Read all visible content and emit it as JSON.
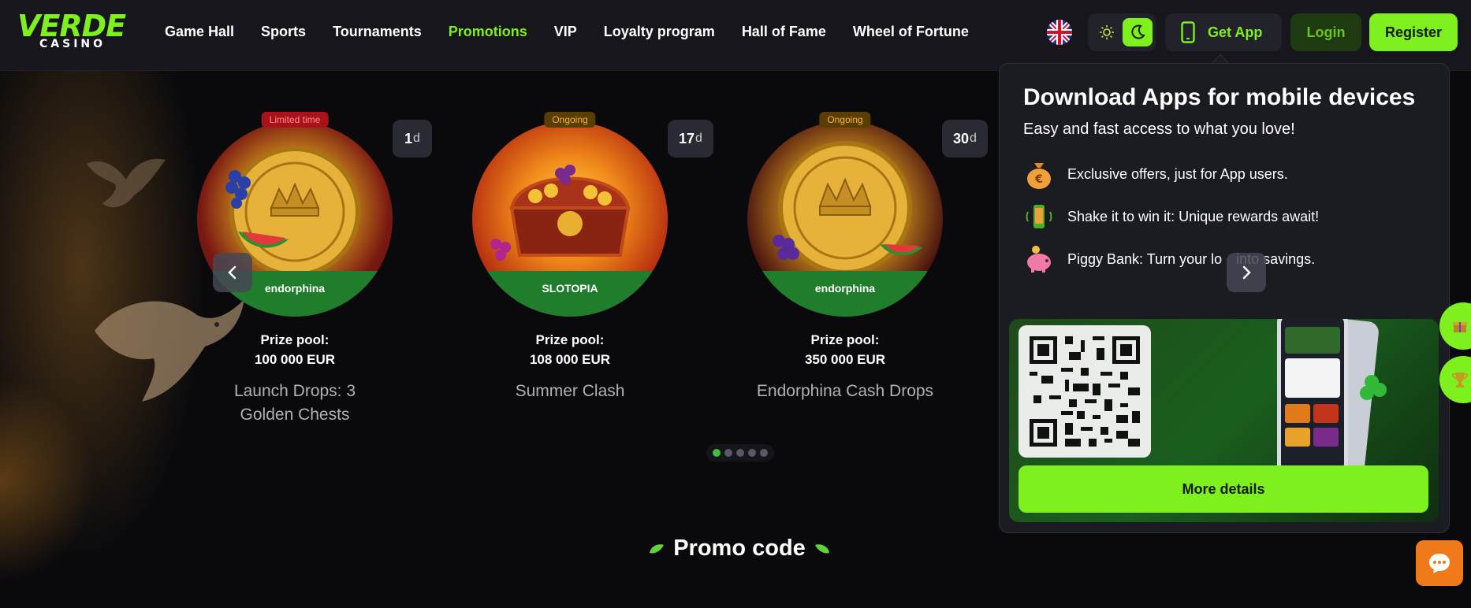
{
  "header": {
    "logo_main": "VERDE",
    "logo_sub": "CASINO",
    "nav": [
      "Game Hall",
      "Sports",
      "Tournaments",
      "Promotions",
      "VIP",
      "Loyalty program",
      "Hall of Fame",
      "Wheel of Fortune"
    ],
    "active_nav": "Promotions",
    "get_app_label": "Get App",
    "login_label": "Login",
    "register_label": "Register"
  },
  "tournaments": [
    {
      "badge": "Limited time",
      "days": "1",
      "days_unit": "d",
      "brand": "endorphina",
      "prize_label": "Prize pool:",
      "prize_value": "100 000 EUR",
      "title": "Launch Drops: 3 Golden Chests"
    },
    {
      "badge": "Ongoing",
      "days": "17",
      "days_unit": "d",
      "brand": "SLOTOPIA",
      "prize_label": "Prize pool:",
      "prize_value": "108 000 EUR",
      "title": "Summer Clash"
    },
    {
      "badge": "Ongoing",
      "days": "30",
      "days_unit": "d",
      "brand": "endorphina",
      "prize_label": "Prize pool:",
      "prize_value": "350 000 EUR",
      "title": "Endorphina Cash Drops"
    }
  ],
  "carousel": {
    "dot_count": 5,
    "active_dot": 0
  },
  "promo_section": {
    "title": "Promo code"
  },
  "popup": {
    "title": "Download Apps for mobile devices",
    "subtitle": "Easy and fast access to what you love!",
    "features": [
      "Exclusive offers, just for App users.",
      "Shake it to win it: Unique rewards await!",
      "Piggy Bank: Turn your lo     into savings."
    ],
    "more_label": "More details"
  },
  "colors": {
    "accent": "#7ef01d",
    "header_bg": "#16161c",
    "page_bg": "#0a0a0d",
    "limited": "#a8121b",
    "ongoing": "#5a3c05"
  }
}
